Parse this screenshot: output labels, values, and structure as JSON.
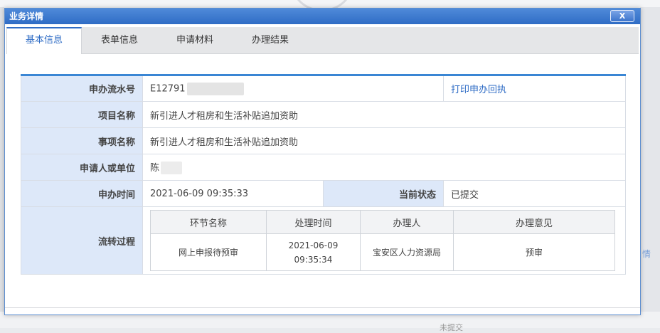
{
  "dialog": {
    "title": "业务详情",
    "close_label": "X"
  },
  "tabs": [
    {
      "label": "基本信息",
      "active": true
    },
    {
      "label": "表单信息",
      "active": false
    },
    {
      "label": "申请材料",
      "active": false
    },
    {
      "label": "办理结果",
      "active": false
    }
  ],
  "info": {
    "serial_label": "申办流水号",
    "serial_value": "E12791",
    "print_link": "打印申办回执",
    "project_label": "项目名称",
    "project_value": "新引进人才租房和生活补贴追加资助",
    "item_label": "事项名称",
    "item_value": "新引进人才租房和生活补贴追加资助",
    "applicant_label": "申请人或单位",
    "applicant_value": "陈",
    "time_label": "申办时间",
    "time_value": "2021-06-09 09:35:33",
    "status_label": "当前状态",
    "status_value": "已提交",
    "flow_label": "流转过程"
  },
  "flow": {
    "headers": [
      "环节名称",
      "处理时间",
      "办理人",
      "办理意见"
    ],
    "rows": [
      [
        "网上申报待预审",
        "2021-06-09 09:35:34",
        "宝安区人力资源局",
        "预审"
      ]
    ]
  },
  "background": {
    "edge_text": "情",
    "low_text": "未提交"
  },
  "colors": {
    "accent": "#2f6cc5",
    "label_bg": "#dde8f9",
    "title_bar": "#3a78d0"
  }
}
